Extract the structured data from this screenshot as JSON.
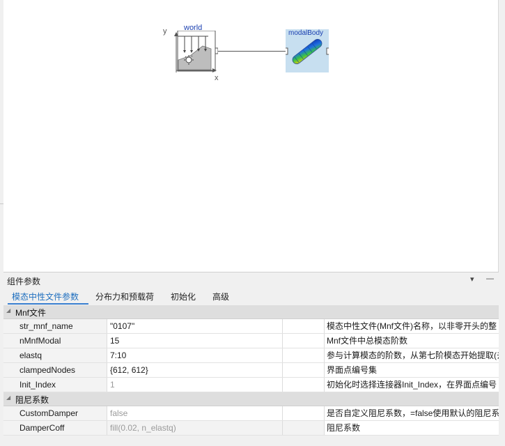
{
  "diagram": {
    "world": {
      "label": "world",
      "axis_y": "y",
      "axis_x": "x"
    },
    "modal_body": {
      "label": "modalBody"
    }
  },
  "panel": {
    "title": "组件参数",
    "tabs": [
      {
        "label": "模态中性文件参数",
        "active": true
      },
      {
        "label": "分布力和预载荷",
        "active": false
      },
      {
        "label": "初始化",
        "active": false
      },
      {
        "label": "高级",
        "active": false
      }
    ]
  },
  "groups": [
    {
      "label": "Mnf文件",
      "rows": [
        {
          "name": "str_mnf_name",
          "value": "\"0107\"",
          "unit": "",
          "description": "模态中性文件(Mnf文件)名称，以非零开头的整"
        },
        {
          "name": "nMnfModal",
          "value": "15",
          "unit": "",
          "description": "Mnf文件中总模态阶数"
        },
        {
          "name": "elastq",
          "value": "7:10",
          "unit": "",
          "description": "参与计算模态的阶数，从第七阶模态开始提取(去"
        },
        {
          "name": "clampedNodes",
          "value": "{612, 612}",
          "unit": "",
          "description": "界面点编号集"
        },
        {
          "name": "Init_Index",
          "value": "1",
          "unit": "",
          "description": "初始化时选择连接器Init_Index，在界面点编号"
        }
      ]
    },
    {
      "label": "阻尼系数",
      "rows": [
        {
          "name": "CustomDamper",
          "value": "false",
          "unit": "",
          "description": "是否自定义阻尼系数，=false使用默认的阻尼系"
        },
        {
          "name": "DamperCoff",
          "value": "fill(0.02, n_elastq)",
          "unit": "",
          "description": "阻尼系数"
        }
      ]
    }
  ],
  "colors": {
    "accent": "#1f6fbf",
    "modal_block_bg": "#c7dff0",
    "diagram_label": "#1a3fb0"
  }
}
